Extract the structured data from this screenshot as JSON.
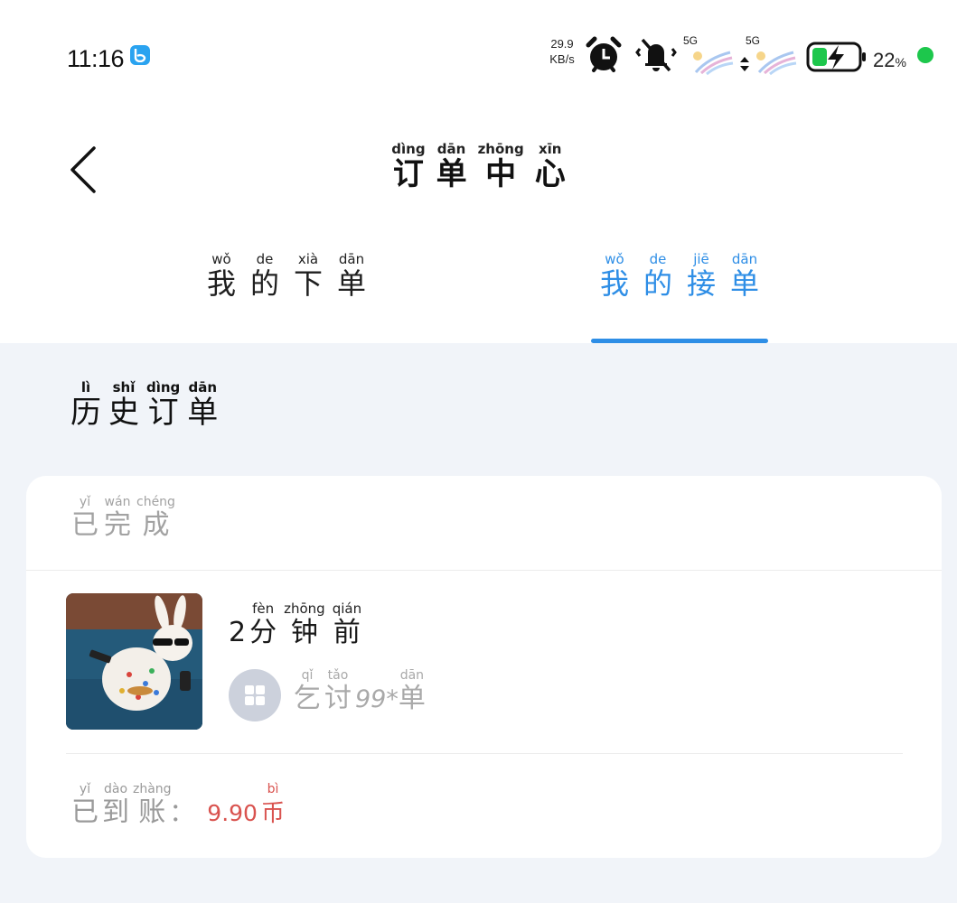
{
  "status_bar": {
    "time": "11:16",
    "net_speed_value": "29.9",
    "net_speed_unit": "KB/s",
    "signal_1": "5G",
    "signal_2": "5G",
    "battery_percent": "22",
    "battery_percent_sign": "%",
    "colors": {
      "battery_fill": "#1dc74c",
      "app_icon": "#2aa3f0"
    },
    "icons": [
      "app-notification-icon",
      "alarm-icon",
      "mute-icon",
      "signal-5g-icon",
      "data-arrows-icon",
      "signal-5g-icon",
      "battery-charging-icon",
      "privacy-dot-icon"
    ]
  },
  "header": {
    "back_icon": "chevron-left-icon",
    "title": [
      {
        "char": "订",
        "pinyin": "dìng"
      },
      {
        "char": "单",
        "pinyin": "dān"
      },
      {
        "char": "中",
        "pinyin": "zhōng"
      },
      {
        "char": "心",
        "pinyin": "xīn"
      }
    ]
  },
  "tabs": {
    "my_orders": [
      {
        "char": "我",
        "pinyin": "wǒ"
      },
      {
        "char": "的",
        "pinyin": "de"
      },
      {
        "char": "下",
        "pinyin": "xià"
      },
      {
        "char": "单",
        "pinyin": "dān"
      }
    ],
    "my_accepted": [
      {
        "char": "我",
        "pinyin": "wǒ"
      },
      {
        "char": "的",
        "pinyin": "de"
      },
      {
        "char": "接",
        "pinyin": "jiē"
      },
      {
        "char": "单",
        "pinyin": "dān"
      }
    ],
    "active_tab": "my_accepted",
    "active_color": "#2e8ee6"
  },
  "section": {
    "title": [
      {
        "char": "历",
        "pinyin": "lì"
      },
      {
        "char": "史",
        "pinyin": "shǐ"
      },
      {
        "char": "订",
        "pinyin": "dìng"
      },
      {
        "char": "单",
        "pinyin": "dān"
      }
    ]
  },
  "order": {
    "status": [
      {
        "char": "已",
        "pinyin": "yǐ"
      },
      {
        "char": "完",
        "pinyin": "wán"
      },
      {
        "char": "成",
        "pinyin": "chéng"
      }
    ],
    "time_num": "2",
    "time_text": [
      {
        "char": "分",
        "pinyin": "fèn"
      },
      {
        "char": "钟",
        "pinyin": "zhōng"
      },
      {
        "char": "前",
        "pinyin": "qián"
      }
    ],
    "user_prefix": [
      {
        "char": "乞",
        "pinyin": "qǐ"
      },
      {
        "char": "讨",
        "pinyin": "tǎo"
      }
    ],
    "user_masked": "99*",
    "user_suffix": [
      {
        "char": "单",
        "pinyin": "dān"
      }
    ],
    "paid_label": [
      {
        "char": "已",
        "pinyin": "yǐ"
      },
      {
        "char": "到",
        "pinyin": "dào"
      },
      {
        "char": "账",
        "pinyin": "zhàng"
      }
    ],
    "paid_colon": "：",
    "amount": "9.90",
    "currency": [
      {
        "char": "币",
        "pinyin": "bì"
      }
    ],
    "amount_color": "#d9534f",
    "thumbnail_icon": "order-photo-icon",
    "avatar_icon": "avatar-placeholder-icon"
  }
}
